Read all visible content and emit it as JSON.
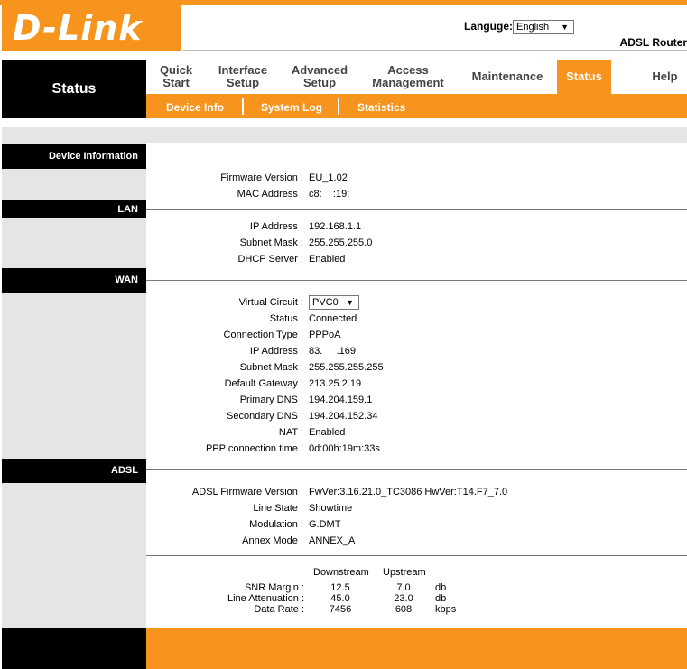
{
  "header": {
    "logo": "D-Link",
    "language_label": "Languge:",
    "language_value": "English",
    "model": "ADSL Router"
  },
  "side_title": "Status",
  "nav": [
    {
      "label": "Quick Start"
    },
    {
      "label": "Interface Setup"
    },
    {
      "label": "Advanced Setup"
    },
    {
      "label": "Access Management"
    },
    {
      "label": "Maintenance"
    },
    {
      "label": "Status"
    },
    {
      "label": "Help"
    }
  ],
  "subnav": [
    "Device Info",
    "System Log",
    "Statistics"
  ],
  "sections": {
    "device": {
      "title": "Device Information",
      "rows": [
        {
          "label": "Firmware Version :",
          "value": "EU_1.02"
        },
        {
          "label": "MAC Address :",
          "value": "c8:    :19:"
        }
      ]
    },
    "lan": {
      "title": "LAN",
      "rows": [
        {
          "label": "IP Address :",
          "value": "192.168.1.1"
        },
        {
          "label": "Subnet Mask :",
          "value": "255.255.255.0"
        },
        {
          "label": "DHCP Server :",
          "value": "Enabled"
        }
      ]
    },
    "wan": {
      "title": "WAN",
      "virtual_circuit_label": "Virtual Circuit :",
      "virtual_circuit_value": "PVC0",
      "rows": [
        {
          "label": "Status :",
          "value": "Connected"
        },
        {
          "label": "Connection Type :",
          "value": "PPPoA"
        },
        {
          "label": "IP Address :",
          "value": "83.     .169."
        },
        {
          "label": "Subnet Mask :",
          "value": "255.255.255.255"
        },
        {
          "label": "Default Gateway :",
          "value": "213.25.2.19"
        },
        {
          "label": "Primary DNS :",
          "value": "194.204.159.1"
        },
        {
          "label": "Secondary DNS :",
          "value": "194.204.152.34"
        },
        {
          "label": "NAT :",
          "value": "Enabled"
        },
        {
          "label": "PPP connection time :",
          "value": "0d:00h:19m:33s"
        }
      ]
    },
    "adsl": {
      "title": "ADSL",
      "rows": [
        {
          "label": "ADSL Firmware Version :",
          "value": "FwVer:3.16.21.0_TC3086 HwVer:T14.F7_7.0"
        },
        {
          "label": "Line State :",
          "value": "Showtime"
        },
        {
          "label": "Modulation :",
          "value": "G.DMT"
        },
        {
          "label": "Annex Mode :",
          "value": "ANNEX_A"
        }
      ],
      "stats": {
        "col_downstream": "Downstream",
        "col_upstream": "Upstream",
        "rows": [
          {
            "label": "SNR Margin :",
            "down": "12.5",
            "up": "7.0",
            "unit": "db"
          },
          {
            "label": "Line Attenuation :",
            "down": "45.0",
            "up": "23.0",
            "unit": "db"
          },
          {
            "label": "Data Rate :",
            "down": "7456",
            "up": "608",
            "unit": "kbps"
          }
        ]
      }
    }
  }
}
